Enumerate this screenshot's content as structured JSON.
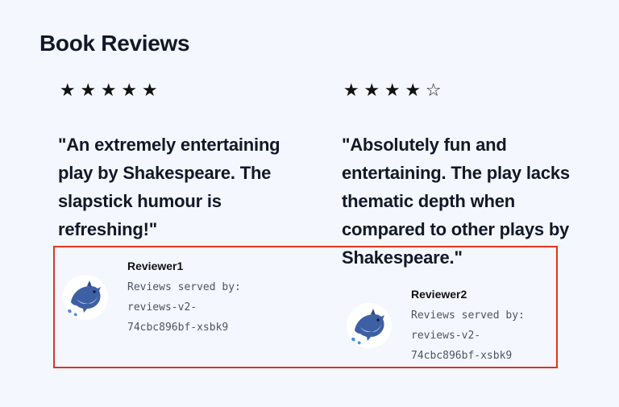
{
  "page": {
    "title": "Book Reviews"
  },
  "reviews": [
    {
      "rating": 5,
      "stars": [
        "★",
        "★",
        "★",
        "★",
        "★"
      ],
      "text": "\"An extremely entertaining play by Shakespeare. The slapstick humour is refreshing!\"",
      "reviewer": "Reviewer1",
      "avatar_icon": "dolphin-icon",
      "served_by_label": "Reviews served by:",
      "served_by_host": "reviews-v2-74cbc896bf-xsbk9"
    },
    {
      "rating": 4,
      "stars": [
        "★",
        "★",
        "★",
        "★",
        "☆"
      ],
      "text": "\"Absolutely fun and entertaining. The play lacks thematic depth when compared to other plays by Shakespeare.\"",
      "reviewer": "Reviewer2",
      "avatar_icon": "dolphin-icon",
      "served_by_label": "Reviews served by:",
      "served_by_host": "reviews-v2-74cbc896bf-xsbk9"
    }
  ],
  "highlight": {
    "color": "#e2341d"
  },
  "colors": {
    "background": "#f5f7fe",
    "text": "#111827",
    "muted": "#4b5563"
  }
}
